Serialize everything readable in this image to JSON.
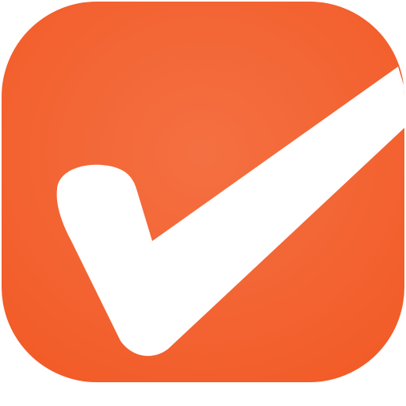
{
  "icon": {
    "name": "checkmark-app-icon",
    "symbol": "checkmark-icon",
    "colors": {
      "tile": "#F25A26",
      "tile_highlight": "#F47042",
      "check": "#FFFFFF"
    }
  }
}
